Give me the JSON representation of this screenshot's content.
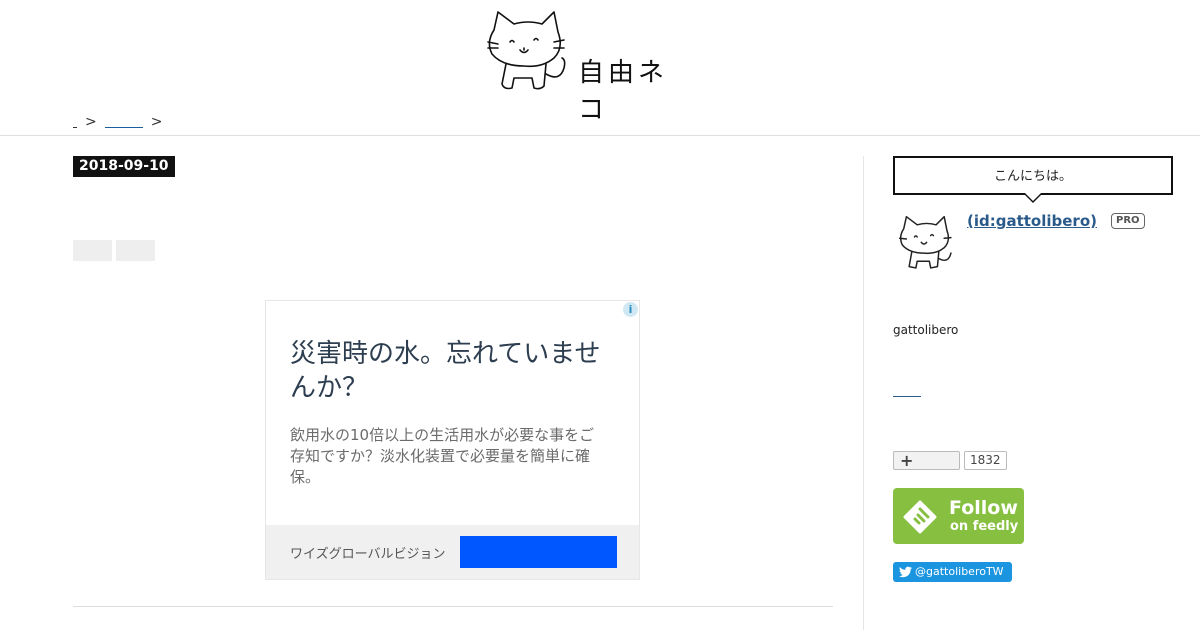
{
  "header": {
    "site_title": "自由ネコ",
    "breadcrumb_sep1": ">",
    "breadcrumb_sep2": ">"
  },
  "article": {
    "date": "2018-09-10"
  },
  "ad": {
    "info_icon": "info-icon",
    "title": "災害時の水。忘れていませんか？",
    "description": "飲用水の10倍以上の生活用水が必要な事をご存知ですか？淡水化装置で必要量を簡単に確保。",
    "advertiser": "ワイズグローバルビジョン",
    "cta_color": "#0057ff"
  },
  "sidebar": {
    "greeting": "こんにちは。",
    "profile_id": "(id:gattolibero)",
    "pro_badge": "PRO",
    "about_text": "gattolibero",
    "reader_plus": "+",
    "reader_count": "1832",
    "feedly_follow": "Follow",
    "feedly_sub": "on feedly",
    "feedly_color": "#87c040",
    "twitter_label": "@gattoliberoTW",
    "twitter_color": "#1b95e0"
  }
}
